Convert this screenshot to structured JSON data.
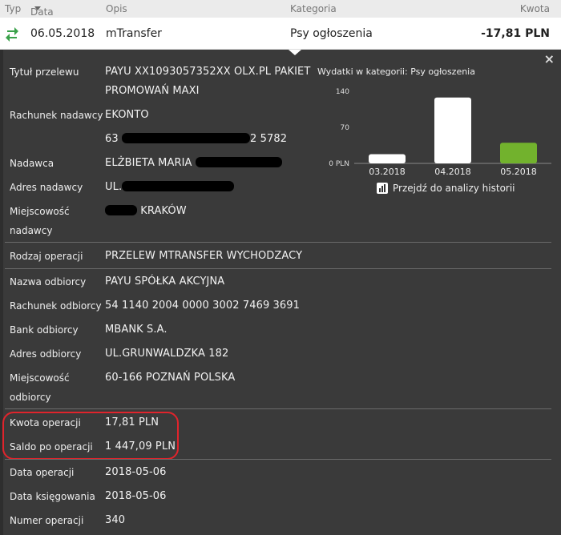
{
  "header": {
    "typ": "Typ",
    "data": "Data",
    "opis": "Opis",
    "kategoria": "Kategoria",
    "kwota": "Kwota"
  },
  "row": {
    "date": "06.05.2018",
    "description": "mTransfer",
    "category": "Psy ogłoszenia",
    "amount": "-17,81 PLN",
    "icon": "transfer-arrows-icon",
    "icon_color": "#3aa14a"
  },
  "close_label": "×",
  "details": {
    "tytul_label": "Tytuł przelewu",
    "tytul_line1": "PAYU XX1093057352XX OLX.PL PAKIET",
    "tytul_line2": "PROMOWAŃ MAXI",
    "rachunek_nadawcy_label": "Rachunek nadawcy",
    "rachunek_nadawcy_line1": "EKONTO",
    "rachunek_nadawcy_prefix": "63",
    "rachunek_nadawcy_suffix": "2 5782",
    "nadawca_label": "Nadawca",
    "nadawca_value": "ELŻBIETA MARIA",
    "adres_nadawcy_label": "Adres nadawcy",
    "adres_nadawcy_value": "UL.",
    "miejscowosc_nadawcy_label1": "Miejscowość",
    "miejscowosc_nadawcy_label2": "nadawcy",
    "miejscowosc_nadawcy_value": "KRAKÓW",
    "rodzaj_label": "Rodzaj operacji",
    "rodzaj_value": "PRZELEW MTRANSFER WYCHODZACY",
    "nazwa_odbiorcy_label": "Nazwa odbiorcy",
    "nazwa_odbiorcy_value": "PAYU SPÓŁKA AKCYJNA",
    "rachunek_odbiorcy_label": "Rachunek odbiorcy",
    "rachunek_odbiorcy_value": "54 1140 2004 0000 3002 7469 3691",
    "bank_odbiorcy_label": "Bank odbiorcy",
    "bank_odbiorcy_value": "MBANK S.A.",
    "adres_odbiorcy_label": "Adres odbiorcy",
    "adres_odbiorcy_value": "UL.GRUNWALDZKA 182",
    "miejscowosc_odbiorcy_label1": "Miejscowość",
    "miejscowosc_odbiorcy_label2": "odbiorcy",
    "miejscowosc_odbiorcy_value": "60-166 POZNAŃ POLSKA",
    "kwota_label": "Kwota operacji",
    "kwota_value": "17,81 PLN",
    "saldo_label": "Saldo po operacji",
    "saldo_value": "1 447,09 PLN",
    "data_operacji_label": "Data operacji",
    "data_operacji_value": "2018-05-06",
    "data_ksiegowania_label": "Data księgowania",
    "data_ksiegowania_value": "2018-05-06",
    "numer_label": "Numer operacji",
    "numer_value": "340"
  },
  "chart_title": "Wydatki w kategorii:  Psy ogłoszenia",
  "chart_link": "Przejdź do analizy historii",
  "chart_data": {
    "type": "bar",
    "categories": [
      "03.2018",
      "04.2018",
      "05.2018"
    ],
    "values": [
      17.81,
      128,
      40
    ],
    "yticks": [
      "0 PLN",
      "70",
      "140"
    ],
    "ylim": [
      0,
      140
    ],
    "colors": [
      "#ffffff",
      "#ffffff",
      "#72b22d"
    ]
  }
}
